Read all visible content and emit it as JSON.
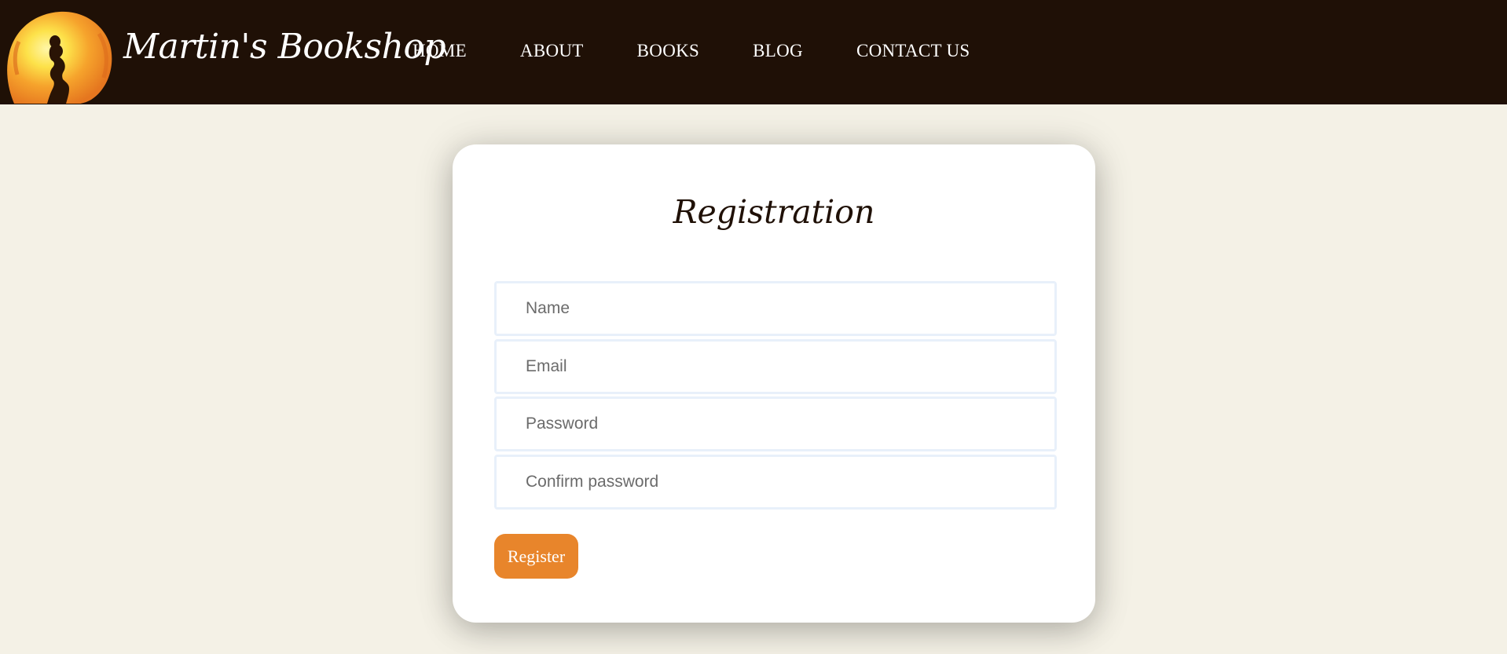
{
  "brand": {
    "name": "Martin's Bookshop",
    "logo": "sunset-reader-logo-icon"
  },
  "nav": {
    "items": [
      {
        "label": "HOME"
      },
      {
        "label": "ABOUT"
      },
      {
        "label": "BOOKS"
      },
      {
        "label": "BLOG"
      },
      {
        "label": "CONTACT US"
      }
    ]
  },
  "form": {
    "title": "Registration",
    "fields": {
      "name": {
        "placeholder": "Name",
        "value": ""
      },
      "email": {
        "placeholder": "Email",
        "value": ""
      },
      "password": {
        "placeholder": "Password",
        "value": ""
      },
      "confirm_password": {
        "placeholder": "Confirm password",
        "value": ""
      }
    },
    "submit_label": "Register"
  },
  "colors": {
    "header_bg": "#1f1006",
    "page_bg": "#f4f1e6",
    "accent": "#e8852b",
    "card_bg": "#ffffff",
    "field_border": "#e8f0fa"
  }
}
